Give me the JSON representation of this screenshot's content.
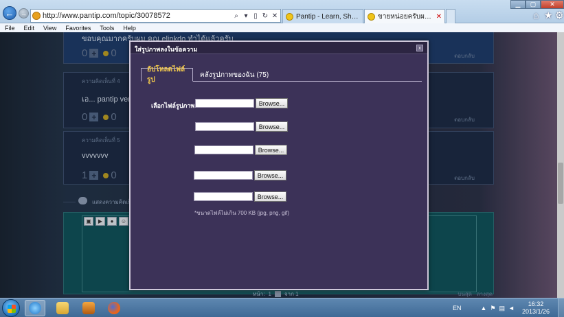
{
  "browser": {
    "url": "http://www.pantip.com/topic/30078572",
    "tabs": [
      {
        "label": "Pantip - Learn, Share & Fun"
      },
      {
        "label": "ขายหน่อยครับผม IPAD MINI..."
      }
    ],
    "menu": [
      "File",
      "Edit",
      "View",
      "Favorites",
      "Tools",
      "Help"
    ]
  },
  "page": {
    "comments": [
      {
        "meta": "",
        "body": "ขอบคุณมากครับผม คุณ elinkdo  ทำได้แล้วครับ",
        "votes": "0",
        "emo": "0",
        "reply": "ตอบกลับ"
      },
      {
        "meta": "ความคิดเห็นที่ 4",
        "body": "เอ... pantip vers",
        "votes": "0",
        "emo": "0",
        "reply": "ตอบกลับ"
      },
      {
        "meta": "ความคิดเห็นที่ 5",
        "body": "vvvvvvv",
        "votes": "1",
        "emo": "0",
        "reply": "ตอบกลับ"
      }
    ],
    "comment_header": "แสดงความคิดเห็",
    "pager": {
      "label": "หน้า:",
      "page": "1",
      "of": "จาก 1",
      "top": "บนสุด",
      "bottom": "ล่างสุด"
    }
  },
  "modal": {
    "title": "ใส่รูปภาพลงในข้อความ",
    "tabs": {
      "upload": "อัปโหลดไฟล์รูป",
      "library": "คลังรูปภาพของฉัน (75)"
    },
    "choose_label": "เลือกไฟล์รูปภาพ",
    "browse_label": "Browse...",
    "note": "*ขนาดไฟล์ไม่เกิน 700 KB (jpg, png, gif)",
    "close": "x"
  },
  "taskbar": {
    "lang": "EN",
    "time": "16:32",
    "date": "2013/1/26"
  }
}
